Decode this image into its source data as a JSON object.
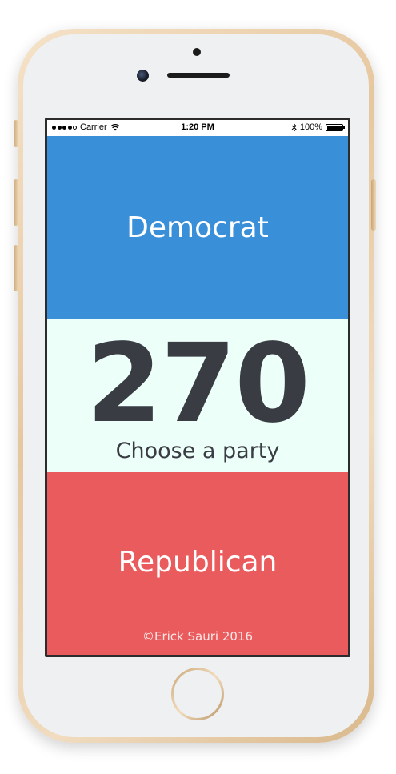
{
  "status_bar": {
    "carrier": "Carrier",
    "time": "1:20 PM",
    "battery_percent": "100%",
    "signal_icon": "signal-dots-icon",
    "wifi_icon": "wifi-icon",
    "bluetooth_icon": "bluetooth-icon",
    "battery_icon": "battery-icon"
  },
  "app": {
    "democrat_label": "Democrat",
    "republican_label": "Republican",
    "electoral_number": "270",
    "prompt": "Choose a party",
    "copyright": "©Erick Sauri 2016"
  },
  "colors": {
    "democrat": "#3a8fd9",
    "middle": "#ecfff9",
    "republican": "#e95b5c",
    "number_text": "#3a3c44"
  }
}
